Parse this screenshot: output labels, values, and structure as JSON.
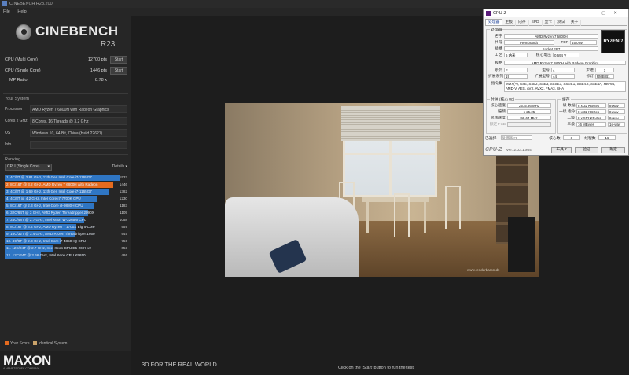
{
  "window": {
    "title": "CINEBENCH R23.200",
    "menu": [
      "File",
      "Help"
    ]
  },
  "logo": {
    "name": "CINEBENCH",
    "version": "R23"
  },
  "scores": [
    {
      "label": "CPU (Multi Core)",
      "value": "12700 pts",
      "button": "Start"
    },
    {
      "label": "CPU (Single Core)",
      "value": "1446 pts",
      "button": "Start"
    },
    {
      "label": "MP Ratio",
      "value": "8.78 x"
    }
  ],
  "system": {
    "heading": "Your System",
    "rows": [
      {
        "key": "Processor",
        "value": "AMD Ryzen 7 6800H with Radeon Graphics"
      },
      {
        "key": "Cores x GHz",
        "value": "8 Cores, 16 Threads @ 3.2 GHz"
      },
      {
        "key": "OS",
        "value": "Windows 10, 64 Bit, China (build 22621)"
      },
      {
        "key": "Info",
        "value": ""
      }
    ]
  },
  "ranking": {
    "heading": "Ranking",
    "mode": "CPU (Single Core)",
    "details_label": "Details",
    "items": [
      {
        "text": "1. 4C/8T @ 2.81 GHz, 11th Gen Intel Core i7-1165G7",
        "score": "1532",
        "fraction": 1.0,
        "me": false
      },
      {
        "text": "2. 8C/16T @ 3.2 GHz, AMD Ryzen 7 6800H with Radeon",
        "score": "1446",
        "fraction": 0.944,
        "me": true
      },
      {
        "text": "3. 4C/8T @ 1.69 GHz, 11th Gen Intel Core i7-1165G7",
        "score": "1382",
        "fraction": 0.902,
        "me": false
      },
      {
        "text": "4. 4C/8T @ 4.2 GHz, Intel Core i7-7700K CPU",
        "score": "1230",
        "fraction": 0.803,
        "me": false
      },
      {
        "text": "5. 8C/16T @ 2.3 GHz, Intel Core i9-9880H CPU",
        "score": "1183",
        "fraction": 0.772,
        "me": false
      },
      {
        "text": "6. 32C/64T @ 3 GHz, AMD Ryzen Threadripper 2990X",
        "score": "1109",
        "fraction": 0.724,
        "me": false
      },
      {
        "text": "7. 24C/48T @ 2.7 GHz, Intel Xeon W-3265M CPU",
        "score": "1058",
        "fraction": 0.691,
        "me": false
      },
      {
        "text": "8. 8C/16T @ 3.4 GHz, AMD Ryzen 7 1700X Eight-Core",
        "score": "959",
        "fraction": 0.626,
        "me": false
      },
      {
        "text": "9. 16C/32T @ 3.4 GHz, AMD Ryzen Threadripper 1950",
        "score": "945",
        "fraction": 0.617,
        "me": false
      },
      {
        "text": "10. 4C/8T @ 2.3 GHz, Intel Core i7-4850HQ CPU",
        "score": "750",
        "fraction": 0.49,
        "me": false
      },
      {
        "text": "11. 12C/24T @ 2.7 GHz, Intel Xeon CPU E5-2697 v2",
        "score": "653",
        "fraction": 0.426,
        "me": false
      },
      {
        "text": "12. 12C/24T @ 2.66 GHz, Intel Xeon CPU X5650",
        "score": "486",
        "fraction": 0.317,
        "me": false
      }
    ],
    "legend": {
      "your_score": "Your Score",
      "identical": "Identical System"
    }
  },
  "footer": {
    "brand": "MAXON",
    "brand_sub": "A NEMETSCHEK COMPANY",
    "tagline": "3D FOR THE REAL WORLD",
    "status": "Click on the 'Start' button to run the test."
  },
  "scene": {
    "watermark": "www.renderbaron.de"
  },
  "cpuz": {
    "title": "CPU-Z",
    "tabs": [
      "处理器",
      "主板",
      "内存",
      "SPD",
      "显卡",
      "测试",
      "关于"
    ],
    "processor_group": "处理器",
    "name_k": "名字",
    "name_v": "AMD Ryzen 7 6800H",
    "codename_k": "代号",
    "codename_v": "Rembrandt",
    "tdp_k": "TDP",
    "tdp_v": "45.0 W",
    "package_k": "插槽",
    "package_v": "Socket FP7",
    "tech_k": "工艺",
    "tech_v": "6 纳米",
    "voltage_k": "核心电压",
    "voltage_v": "0.694 V",
    "spec_k": "规格",
    "spec_v": "AMD Ryzen 7 6800H with Radeon Graphics",
    "family_k": "系列",
    "family_v": "F",
    "model_k": "型号",
    "model_v": "4",
    "stepping_k": "步进",
    "stepping_v": "1",
    "extfam_k": "扩展系列",
    "extfam_v": "19",
    "extmodel_k": "扩展型号",
    "extmodel_v": "44",
    "rev_k": "修订",
    "rev_v": "RMB-B1",
    "instr_k": "指令集",
    "instr_v": "MMX(+), SSE, SSE2, SSE3, SSSE3, SSE4.1, SSE4.2, SSE4A, x86-64, AMD-V, AES, AVX, AVX2, FMA3, SHA",
    "logo_text": "RYZEN 7",
    "clocks_group": "时钟 (核心 #0)",
    "corespeed_k": "核心速度",
    "corespeed_v": "2515.86 MHz",
    "mult_k": "倍频",
    "mult_v": "x 25.25",
    "bus_k": "总线速度",
    "bus_v": "99.64 MHz",
    "fsb_k": "额定 FSB",
    "fsb_v": "",
    "cache_group": "缓存",
    "l1d_k": "一级 数据",
    "l1d_v": "8 x 32 KBytes",
    "l1d_w": "8-way",
    "l1i_k": "一级 指令",
    "l1i_v": "8 x 32 KBytes",
    "l1i_w": "8-way",
    "l2_k": "二级",
    "l2_v": "8 x 512 KBytes",
    "l2_w": "8-way",
    "l3_k": "三级",
    "l3_v": "16 MBytes",
    "l3_w": "16-way",
    "selected_k": "已选择",
    "selected_v": "处理器 #1",
    "cores_k": "核心数",
    "cores_v": "8",
    "threads_k": "线程数",
    "threads_v": "16",
    "brand": "CPU-Z",
    "version": "Ver. 2.03.1.x64",
    "tools_btn": "工具",
    "validate_btn": "验证",
    "ok_btn": "确定"
  }
}
